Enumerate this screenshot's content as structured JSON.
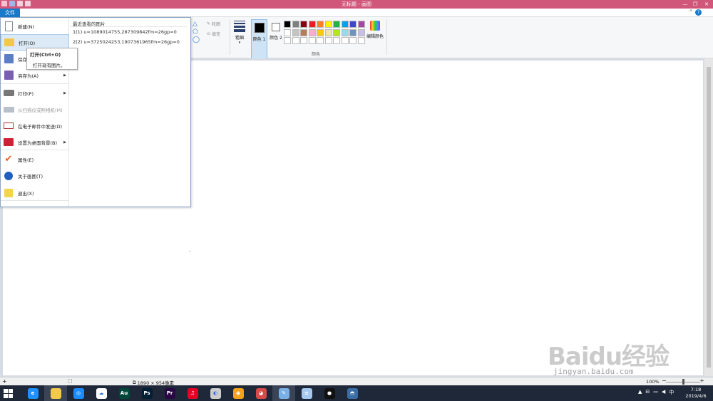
{
  "window": {
    "title": "无标题 - 画图",
    "controls": [
      "minimize",
      "restore",
      "close"
    ]
  },
  "ribbon": {
    "file_tab": "文件",
    "shapes_outline": "轮廓",
    "shapes_fill": "填充",
    "thickness_label": "粗细",
    "color1_label": "颜色 1",
    "color2_label": "颜色 2",
    "edit_colors_label": "编辑颜色",
    "colors_group_label": "颜色",
    "palette": [
      "#000000",
      "#7f7f7f",
      "#880015",
      "#ed1c24",
      "#ff7f27",
      "#fff200",
      "#22b14c",
      "#00a2e8",
      "#3f48cc",
      "#a349a4",
      "#ffffff",
      "#c3c3c3",
      "#b97a57",
      "#ffaec9",
      "#ffc90e",
      "#efe4b0",
      "#b5e61d",
      "#99d9ea",
      "#7092be",
      "#c8bfe7",
      "#ffffff",
      "#ffffff",
      "#ffffff",
      "#ffffff",
      "#ffffff",
      "#ffffff",
      "#ffffff",
      "#ffffff",
      "#ffffff",
      "#ffffff"
    ]
  },
  "file_menu": {
    "items": [
      {
        "label": "新建(N)",
        "icon": "new-file-icon",
        "arrow": false,
        "disabled": false
      },
      {
        "label": "打开(O)",
        "icon": "open-folder-icon",
        "arrow": false,
        "disabled": false
      },
      {
        "label": "保存(S)",
        "icon": "save-icon",
        "arrow": false,
        "disabled": false
      },
      {
        "label": "另存为(A)",
        "icon": "save-as-icon",
        "arrow": true,
        "disabled": false
      },
      {
        "label": "打印(P)",
        "icon": "printer-icon",
        "arrow": true,
        "disabled": false
      },
      {
        "label": "从扫描仪或照相机(M)",
        "icon": "scanner-icon",
        "arrow": false,
        "disabled": true
      },
      {
        "label": "在电子邮件中发送(D)",
        "icon": "email-icon",
        "arrow": false,
        "disabled": false
      },
      {
        "label": "设置为桌面背景(B)",
        "icon": "desktop-background-icon",
        "arrow": true,
        "disabled": false
      },
      {
        "label": "属性(E)",
        "icon": "properties-check-icon",
        "arrow": false,
        "disabled": false
      },
      {
        "label": "关于画图(T)",
        "icon": "info-icon",
        "arrow": false,
        "disabled": false
      },
      {
        "label": "退出(X)",
        "icon": "exit-icon",
        "arrow": false,
        "disabled": false
      }
    ],
    "recent_title": "最近查看的图片",
    "recent": [
      "1(1)  u=1089014755,287309842fm=26gp=0",
      "2(2)  u=3725024253,1907361965fm=26gp=0"
    ]
  },
  "tooltip": {
    "title": "打开(Ctrl+O)",
    "description": "打开现有图片。"
  },
  "status": {
    "image_size": "1890 × 954像素",
    "zoom": "100%",
    "zoom_level": 0.5
  },
  "taskbar": {
    "apps": [
      {
        "name": "ie-icon",
        "color": "#1e90ff",
        "glyph": "e",
        "active": false
      },
      {
        "name": "file-explorer-icon",
        "color": "#f2c94c",
        "glyph": "",
        "active": true
      },
      {
        "name": "browser-icon",
        "color": "#1a8cff",
        "glyph": "◎",
        "active": false
      },
      {
        "name": "baidu-netdisk-icon",
        "color": "#ffffff",
        "glyph": "☁",
        "active": false
      },
      {
        "name": "audition-icon",
        "color": "#00483a",
        "glyph": "Au",
        "active": false
      },
      {
        "name": "photoshop-icon",
        "color": "#001e36",
        "glyph": "Ps",
        "active": false
      },
      {
        "name": "premiere-icon",
        "color": "#2a0845",
        "glyph": "Pr",
        "active": false
      },
      {
        "name": "netease-music-icon",
        "color": "#e60026",
        "glyph": "♫",
        "active": false
      },
      {
        "name": "game-icon",
        "color": "#cccccc",
        "glyph": "◐",
        "active": false
      },
      {
        "name": "weibo-icon",
        "color": "#f7a21b",
        "glyph": "◉",
        "active": false
      },
      {
        "name": "media-icon",
        "color": "#d74b4b",
        "glyph": "◕",
        "active": false
      },
      {
        "name": "paint-icon",
        "color": "#7ab0e6",
        "glyph": "✎",
        "active": true
      },
      {
        "name": "notepad-icon",
        "color": "#a6c8ef",
        "glyph": "≡",
        "active": false
      },
      {
        "name": "recorder-icon",
        "color": "#111111",
        "glyph": "●",
        "active": false
      },
      {
        "name": "extra-app-icon",
        "color": "#3a6ea5",
        "glyph": "◓",
        "active": false
      }
    ],
    "clock_time": "7:18",
    "clock_date": "2019/4/6"
  },
  "watermark": {
    "logo": "Baidu经验",
    "url": "jingyan.baidu.com"
  }
}
